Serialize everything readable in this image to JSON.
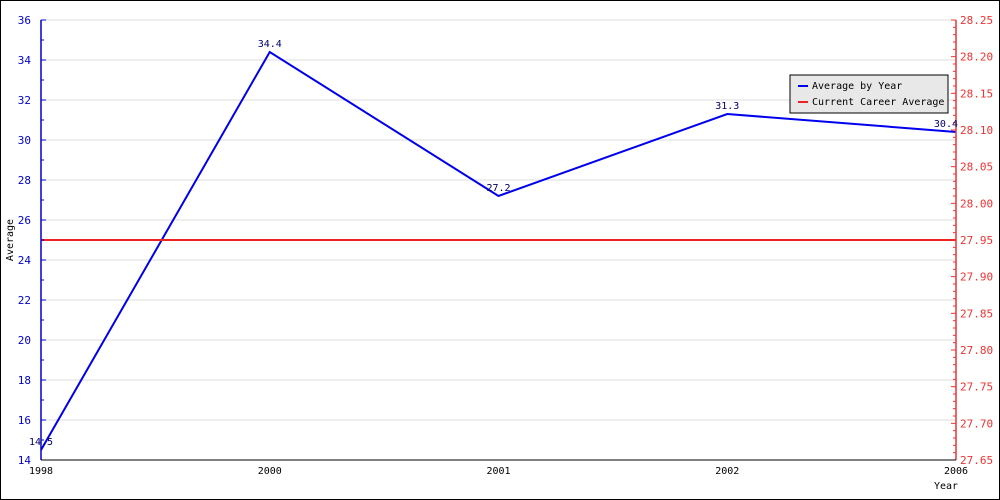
{
  "chart_data": {
    "type": "line",
    "title": "",
    "xlabel": "Year",
    "ylabel": "Average",
    "categories": [
      "1998",
      "2000",
      "2001",
      "2002",
      "2006"
    ],
    "series": [
      {
        "name": "Average by Year",
        "color": "#0000ee",
        "axis": "left",
        "values": [
          14.5,
          34.4,
          27.2,
          31.3,
          30.4
        ],
        "labels": [
          "14.5",
          "34.4",
          "27.2",
          "31.3",
          "30.4"
        ]
      },
      {
        "name": "Current Career Average",
        "color": "#ee2222",
        "axis": "right",
        "values": [
          27.95,
          27.95,
          27.95,
          27.95,
          27.95
        ]
      }
    ],
    "y_left": {
      "range": [
        14,
        36
      ],
      "ticks": [
        "14",
        "16",
        "18",
        "20",
        "22",
        "24",
        "26",
        "28",
        "30",
        "32",
        "34",
        "36"
      ],
      "color": "#0000cc"
    },
    "y_right": {
      "range": [
        27.65,
        28.25
      ],
      "ticks": [
        "27.65",
        "27.70",
        "27.75",
        "27.80",
        "27.85",
        "27.90",
        "27.95",
        "28.00",
        "28.05",
        "28.10",
        "28.15",
        "28.20",
        "28.25"
      ],
      "color": "#ee3333"
    },
    "grid": true,
    "legend": {
      "position": "top-right",
      "entries": [
        "Average by Year",
        "Current Career Average"
      ]
    }
  }
}
